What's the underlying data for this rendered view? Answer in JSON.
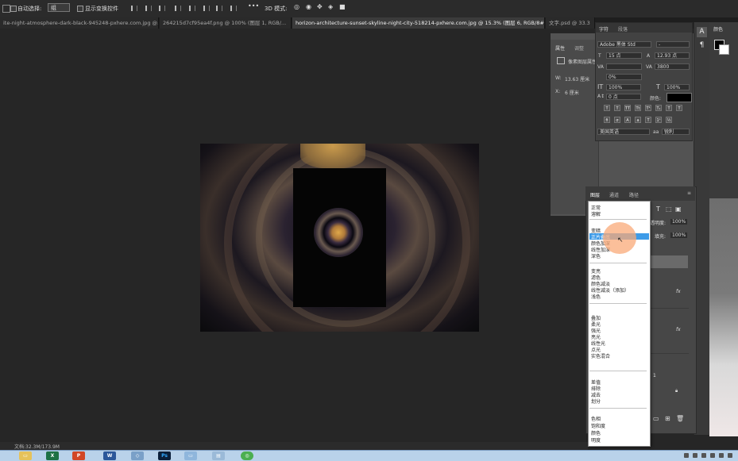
{
  "options_bar": {
    "auto_select_label": "自动选择:",
    "auto_select_value": "组",
    "show_transform_label": "显示变换控件",
    "mode_3d_label": "3D 模式:"
  },
  "doc_tabs": [
    {
      "label": "ite-night-atmosphere-dark-black-945248-pxhere.com.jpg @..."
    },
    {
      "label": "264215d7cf95ea4f.png @ 100% (图层 1, RGB/..."
    },
    {
      "label": "horizon-architecture-sunset-skyline-night-city-518214-pxhere.com.jpg @ 15.3% (图层 6, RGB/8#) *"
    },
    {
      "label": "文字.psd @ 33.3"
    }
  ],
  "properties_panel": {
    "tab_properties": "属性",
    "tab_adjustments": "调整",
    "layer_type": "像素图层属性",
    "width_label": "W:",
    "width_value": "13.63 厘米",
    "x_label": "X:",
    "x_value": "6 厘米"
  },
  "character_panel": {
    "tab_character": "字符",
    "tab_paragraph": "段落",
    "font_family": "Adobe 黑体 Std",
    "font_style": "-",
    "font_size": "15 点",
    "leading": "12.93 点",
    "kerning": "",
    "tracking": "3800",
    "scale_pct": "0%",
    "vertical_scale": "100%",
    "horizontal_scale": "100%",
    "baseline_shift": "0 点",
    "color_label": "颜色:",
    "color_value": "#000000",
    "language": "美国英语",
    "antialias": "锐利"
  },
  "layers_panel": {
    "tab_layers": "图层",
    "tab_channels": "通道",
    "tab_paths": "路径",
    "opacity_label": "透明度:",
    "opacity_value": "100%",
    "fill_label": "填充:",
    "fill_value": "100%",
    "fx_label": "fx",
    "layer_number": "1"
  },
  "blend_menu": {
    "groups": [
      [
        "正常",
        "溶解"
      ],
      [
        "变暗",
        "正片叠底",
        "颜色加深",
        "线性加深",
        "深色"
      ],
      [
        "变亮",
        "滤色",
        "颜色减淡",
        "线性减淡（添加）",
        "浅色"
      ],
      [
        "叠加",
        "柔光",
        "强光",
        "亮光",
        "线性光",
        "点光",
        "实色混合"
      ],
      [
        "差值",
        "排除",
        "减去",
        "划分"
      ],
      [
        "色相",
        "饱和度",
        "颜色",
        "明度"
      ]
    ],
    "highlighted": "正片叠底"
  },
  "status_bar": {
    "doc_size": "文档:32.3M/173.9M"
  },
  "colors": {
    "accent": "#3d9be8",
    "click_indicator": "#f7a878",
    "panel_bg": "#535353",
    "app_bg": "#262626"
  },
  "taskbar": {
    "apps": [
      "explorer",
      "excel",
      "powerpoint",
      "word",
      "network",
      "photoshop",
      "window",
      "folder",
      "browser"
    ]
  }
}
